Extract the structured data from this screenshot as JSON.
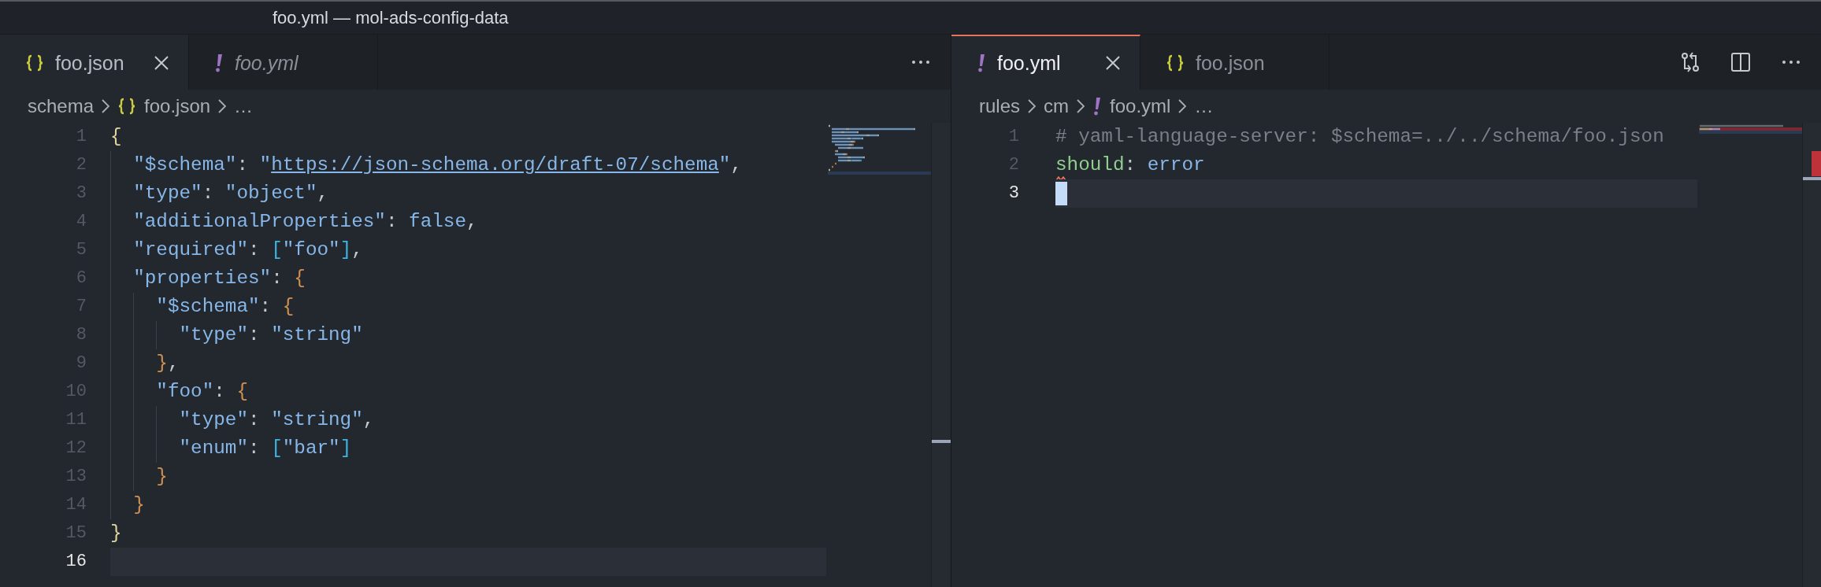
{
  "window": {
    "title": "foo.yml — mol-ads-config-data"
  },
  "editors": [
    {
      "focused": false,
      "tabs": [
        {
          "label": "foo.json",
          "kind": "json",
          "selected": true,
          "preview": false
        },
        {
          "label": "foo.yml",
          "kind": "yaml",
          "selected": false,
          "preview": true
        }
      ],
      "actions": [
        {
          "kind": "more"
        }
      ],
      "breadcrumb": [
        {
          "label": "schema"
        },
        {
          "label": "foo.json",
          "kind": "json"
        },
        {
          "label": "…"
        }
      ],
      "lines": [
        {
          "number": "1",
          "current": false,
          "tokens": [
            {
              "text": "{",
              "kind": "brace1"
            }
          ]
        },
        {
          "number": "2",
          "current": false,
          "tokens": [
            {
              "text": "  \"$schema\"",
              "kind": "key"
            },
            {
              "text": ": ",
              "kind": "punct"
            },
            {
              "text": "\"",
              "kind": "string"
            },
            {
              "text": "https://json-schema.org/draft-07/schema",
              "kind": "link"
            },
            {
              "text": "\"",
              "kind": "string"
            },
            {
              "text": ",",
              "kind": "punct"
            }
          ]
        },
        {
          "number": "3",
          "current": false,
          "tokens": [
            {
              "text": "  \"type\"",
              "kind": "key"
            },
            {
              "text": ": ",
              "kind": "punct"
            },
            {
              "text": "\"object\"",
              "kind": "string"
            },
            {
              "text": ",",
              "kind": "punct"
            }
          ]
        },
        {
          "number": "4",
          "current": false,
          "tokens": [
            {
              "text": "  \"additionalProperties\"",
              "kind": "key"
            },
            {
              "text": ": ",
              "kind": "punct"
            },
            {
              "text": "false",
              "kind": "keyword"
            },
            {
              "text": ",",
              "kind": "punct"
            }
          ]
        },
        {
          "number": "5",
          "current": false,
          "tokens": [
            {
              "text": "  \"required\"",
              "kind": "key"
            },
            {
              "text": ": ",
              "kind": "punct"
            },
            {
              "text": "[",
              "kind": "bracket"
            },
            {
              "text": "\"foo\"",
              "kind": "string"
            },
            {
              "text": "]",
              "kind": "bracket"
            },
            {
              "text": ",",
              "kind": "punct"
            }
          ]
        },
        {
          "number": "6",
          "current": false,
          "tokens": [
            {
              "text": "  \"properties\"",
              "kind": "key"
            },
            {
              "text": ": ",
              "kind": "punct"
            },
            {
              "text": "{",
              "kind": "brace2"
            }
          ]
        },
        {
          "number": "7",
          "current": false,
          "tokens": [
            {
              "text": "    \"$schema\"",
              "kind": "key"
            },
            {
              "text": ": ",
              "kind": "punct"
            },
            {
              "text": "{",
              "kind": "brace2"
            }
          ]
        },
        {
          "number": "8",
          "current": false,
          "tokens": [
            {
              "text": "      \"type\"",
              "kind": "key"
            },
            {
              "text": ": ",
              "kind": "punct"
            },
            {
              "text": "\"string\"",
              "kind": "string"
            }
          ]
        },
        {
          "number": "9",
          "current": false,
          "tokens": [
            {
              "text": "    }",
              "kind": "brace2"
            },
            {
              "text": ",",
              "kind": "punct"
            }
          ]
        },
        {
          "number": "10",
          "current": false,
          "tokens": [
            {
              "text": "    \"foo\"",
              "kind": "key"
            },
            {
              "text": ": ",
              "kind": "punct"
            },
            {
              "text": "{",
              "kind": "brace2"
            }
          ]
        },
        {
          "number": "11",
          "current": false,
          "tokens": [
            {
              "text": "      \"type\"",
              "kind": "key"
            },
            {
              "text": ": ",
              "kind": "punct"
            },
            {
              "text": "\"string\"",
              "kind": "string"
            },
            {
              "text": ",",
              "kind": "punct"
            }
          ]
        },
        {
          "number": "12",
          "current": false,
          "tokens": [
            {
              "text": "      \"enum\"",
              "kind": "key"
            },
            {
              "text": ": ",
              "kind": "punct"
            },
            {
              "text": "[",
              "kind": "bracket"
            },
            {
              "text": "\"bar\"",
              "kind": "string"
            },
            {
              "text": "]",
              "kind": "bracket"
            }
          ]
        },
        {
          "number": "13",
          "current": false,
          "tokens": [
            {
              "text": "    }",
              "kind": "brace2"
            }
          ]
        },
        {
          "number": "14",
          "current": false,
          "tokens": [
            {
              "text": "  }",
              "kind": "brace2"
            }
          ]
        },
        {
          "number": "15",
          "current": false,
          "tokens": [
            {
              "text": "}",
              "kind": "brace1"
            }
          ]
        },
        {
          "number": "16",
          "current": true,
          "cursor": false
        }
      ]
    },
    {
      "focused": true,
      "tabs": [
        {
          "label": "foo.yml",
          "kind": "yaml",
          "selected": true,
          "preview": false
        },
        {
          "label": "foo.json",
          "kind": "json",
          "selected": false,
          "preview": false
        }
      ],
      "actions": [
        {
          "kind": "compare"
        },
        {
          "kind": "split"
        },
        {
          "kind": "more"
        }
      ],
      "breadcrumb": [
        {
          "label": "rules"
        },
        {
          "label": "cm"
        },
        {
          "label": "foo.yml",
          "kind": "yaml"
        },
        {
          "label": "…"
        }
      ],
      "lines": [
        {
          "number": "1",
          "current": false,
          "tokens": [
            {
              "text": "# yaml-language-server: $schema=../../schema/foo.json",
              "kind": "comment"
            }
          ]
        },
        {
          "number": "2",
          "current": false,
          "error": true,
          "tokens": [
            {
              "text": "should",
              "kind": "yamlkey"
            },
            {
              "text": ": ",
              "kind": "punct"
            },
            {
              "text": "error",
              "kind": "string"
            }
          ]
        },
        {
          "number": "3",
          "current": true,
          "cursor": true
        }
      ]
    }
  ]
}
